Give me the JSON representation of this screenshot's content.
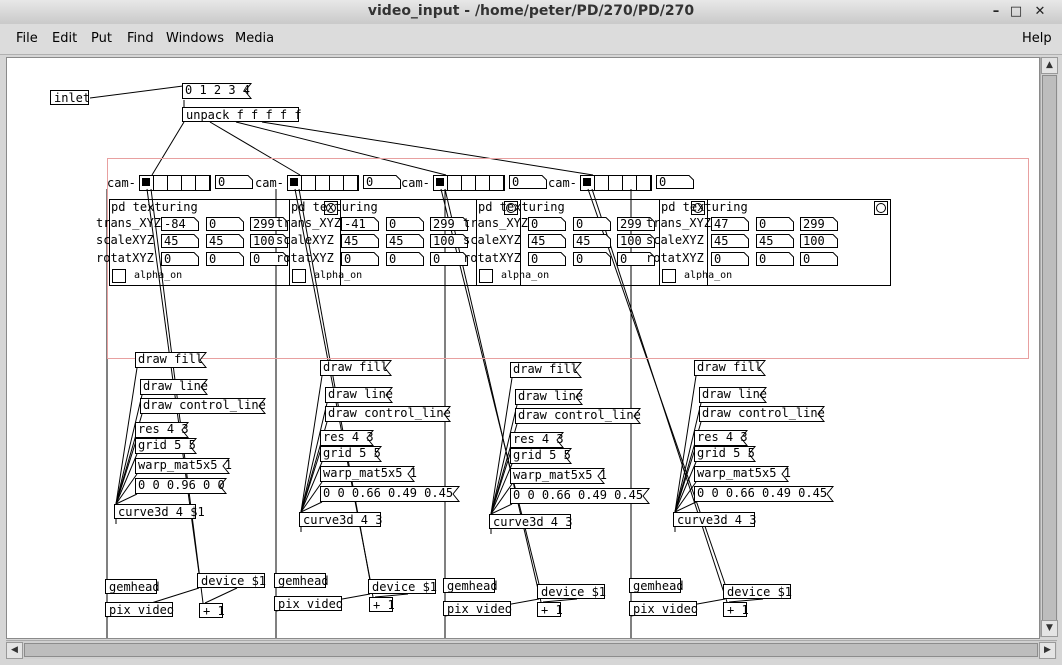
{
  "window": {
    "title": "video_input  - /home/peter/PD/270/PD/270",
    "minimize_glyph": "–",
    "maximize_glyph": "□",
    "close_glyph": "✕"
  },
  "menu": {
    "items": [
      "File",
      "Edit",
      "Put",
      "Find",
      "Windows",
      "Media"
    ],
    "help": "Help"
  },
  "patch": {
    "inlet": "inlet",
    "list_msg": "0 1 2 3 4",
    "unpack": "unpack f f f f f",
    "selection_color": "#e8a0a0",
    "modules": [
      {
        "cam_label": "cam-",
        "cam_value": "0",
        "selected_cell": 0,
        "subpatch": "pd texturing",
        "trans_label": "trans_XYZ",
        "trans": [
          "-84",
          "0",
          "299"
        ],
        "scale_label": "scaleXYZ",
        "scale": [
          "45",
          "45",
          "100"
        ],
        "rotat_label": "rotatXYZ",
        "rotat": [
          "0",
          "0",
          "0"
        ],
        "alpha_label": "alpha_on",
        "msgs": [
          "draw fill",
          "draw line",
          "draw control_line",
          "res 4 3",
          "grid 5 5",
          "warp_mat5x5 1",
          "0 0 0.96 0 0"
        ],
        "curve": "curve3d 4 $1",
        "gemhead": "gemhead",
        "device": "device $1",
        "pix_video": "pix_video",
        "plus": "+ 1"
      },
      {
        "cam_label": "cam-",
        "cam_value": "0",
        "selected_cell": 0,
        "subpatch": "pd texturing",
        "trans_label": "trans_XYZ",
        "trans": [
          "-41",
          "0",
          "299"
        ],
        "scale_label": "scaleXYZ",
        "scale": [
          "45",
          "45",
          "100"
        ],
        "rotat_label": "rotatXYZ",
        "rotat": [
          "0",
          "0",
          "0"
        ],
        "alpha_label": "alpha_on",
        "msgs": [
          "draw fill",
          "draw line",
          "draw control_line",
          "res 4 3",
          "grid 5 5",
          "warp_mat5x5 1",
          "0 0 0.66 0.49 0.45"
        ],
        "curve": "curve3d 4 3",
        "gemhead": "gemhead",
        "device": "device $1",
        "pix_video": "pix_video",
        "plus": "+ 1"
      },
      {
        "cam_label": "cam-",
        "cam_value": "0",
        "selected_cell": 0,
        "subpatch": "pd texturing",
        "trans_label": "trans_XYZ",
        "trans": [
          "0",
          "0",
          "299"
        ],
        "scale_label": "scaleXYZ",
        "scale": [
          "45",
          "45",
          "100"
        ],
        "rotat_label": "rotatXYZ",
        "rotat": [
          "0",
          "0",
          "0"
        ],
        "alpha_label": "alpha_on",
        "msgs": [
          "draw fill",
          "draw line",
          "draw control_line",
          "res 4 3",
          "grid 5 5",
          "warp_mat5x5 1",
          "0 0 0.66 0.49 0.45"
        ],
        "curve": "curve3d 4 3",
        "gemhead": "gemhead",
        "device": "device $1",
        "pix_video": "pix_video",
        "plus": "+ 1"
      },
      {
        "cam_label": "cam-",
        "cam_value": "0",
        "selected_cell": 0,
        "subpatch": "pd texturing",
        "trans_label": "trans_XYZ",
        "trans": [
          "47",
          "0",
          "299"
        ],
        "scale_label": "scaleXYZ",
        "scale": [
          "45",
          "45",
          "100"
        ],
        "rotat_label": "rotatXYZ",
        "rotat": [
          "0",
          "0",
          "0"
        ],
        "alpha_label": "alpha_on",
        "msgs": [
          "draw fill",
          "draw line",
          "draw control_line",
          "res 4 3",
          "grid 5 5",
          "warp_mat5x5 1",
          "0 0 0.66 0.49 0.45"
        ],
        "curve": "curve3d 4 3",
        "gemhead": "gemhead",
        "device": "device $1",
        "pix_video": "pix_video",
        "plus": "+ 1"
      }
    ]
  },
  "scroll": {
    "up": "▲",
    "down": "▼",
    "left": "◀",
    "right": "▶"
  }
}
